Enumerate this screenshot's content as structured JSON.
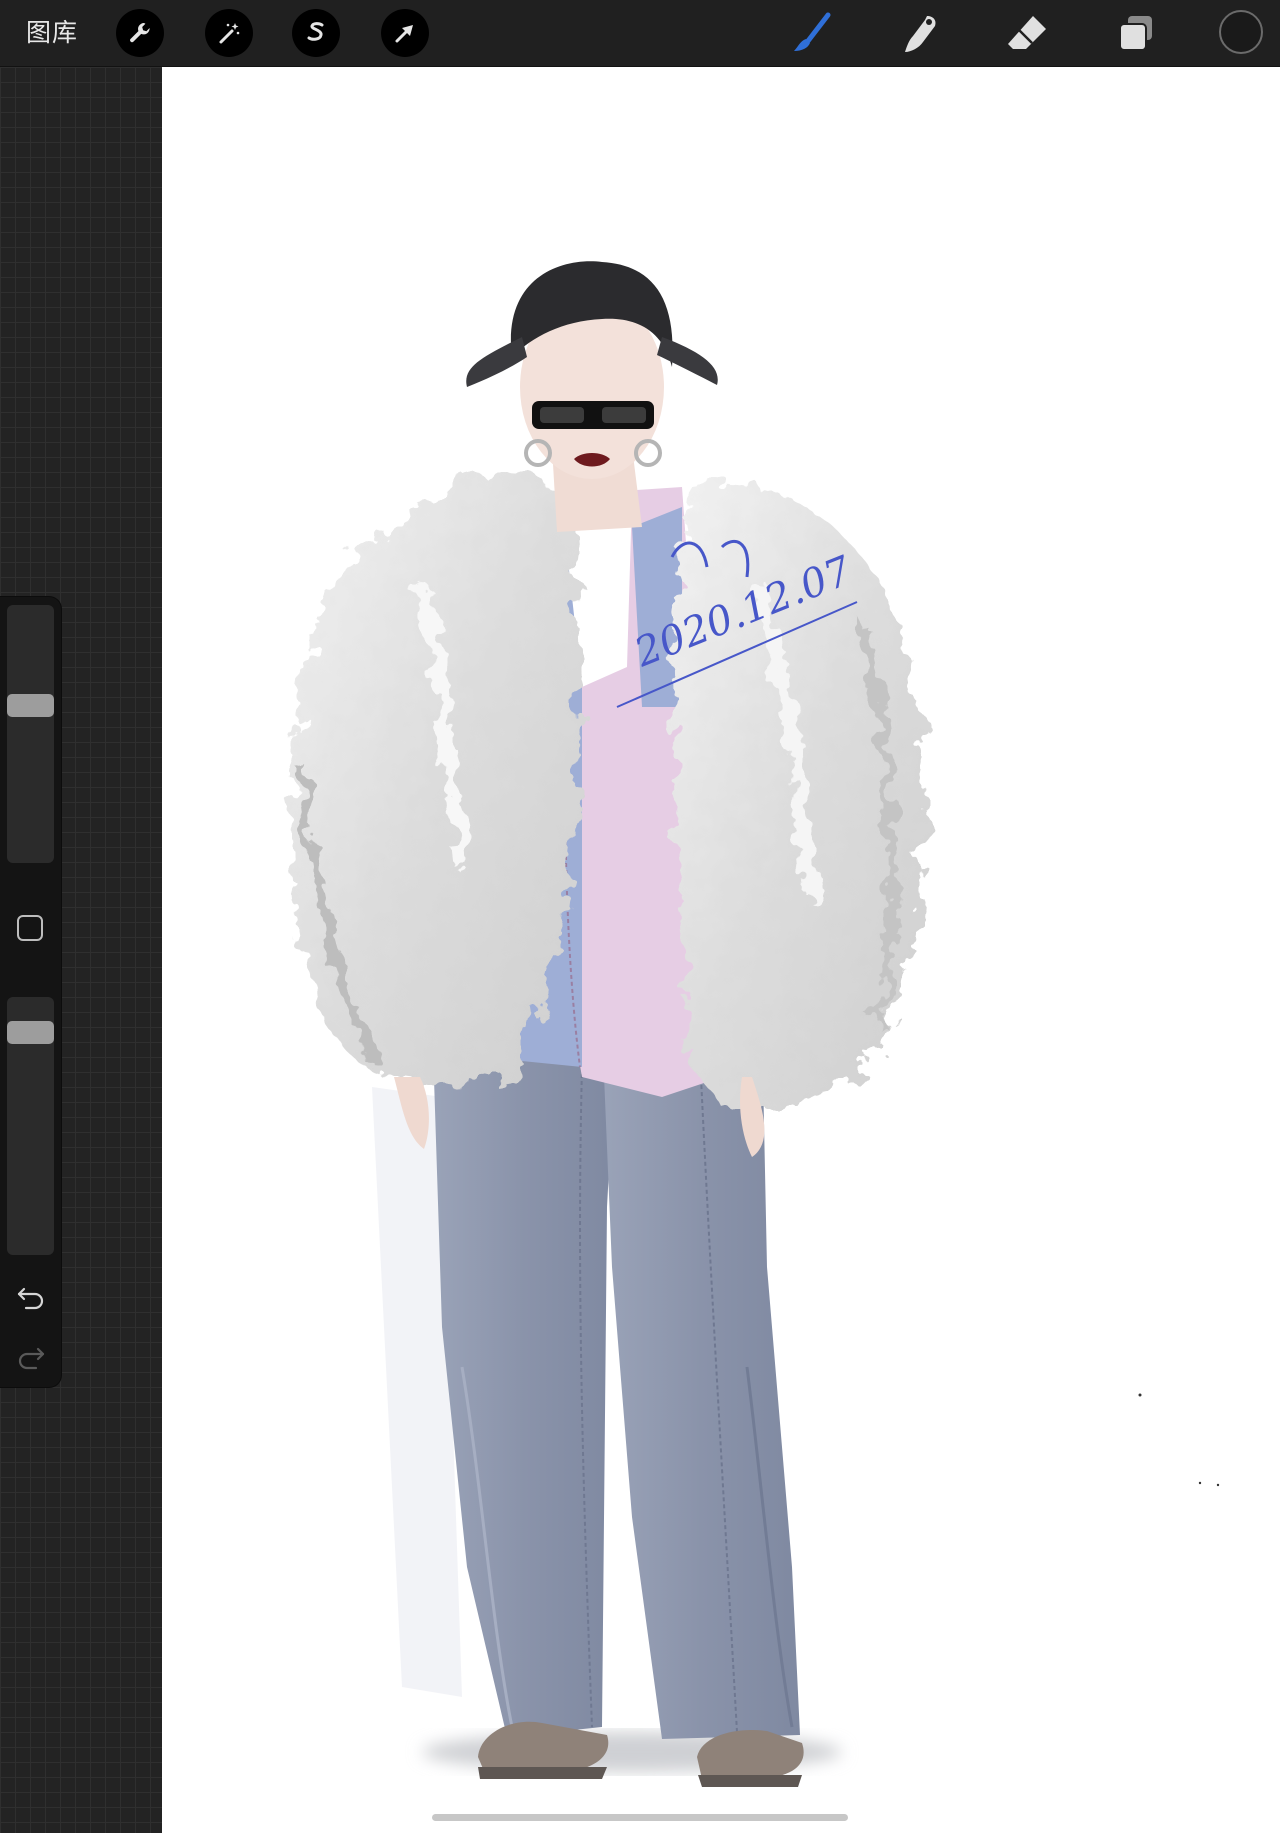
{
  "toolbar": {
    "gallery_label": "图库",
    "left_tools": [
      "wrench-icon",
      "magic-wand-icon",
      "selection-s-icon",
      "transform-arrow-icon"
    ],
    "right_tools": [
      "brush-icon",
      "smudge-icon",
      "eraser-icon",
      "layers-icon"
    ],
    "active_tool": "brush-icon",
    "active_color": "#1f1f1f",
    "accent": "#2f6fd8"
  },
  "sidebar": {
    "brush_size": 0.62,
    "opacity": 0.9,
    "icons": [
      "modify-square-icon",
      "undo-icon",
      "redo-icon"
    ]
  },
  "canvas": {
    "artwork": "fashion-illustration",
    "signature": "2020.12.07",
    "colors": {
      "fur": "#e6e6e6",
      "shirt_pink": "#e6cde4",
      "shirt_blue": "#9eaed6",
      "pants": "#8e97ad",
      "shoes": "#8f8279",
      "hair": "#2b2b2e",
      "lips": "#6e1a1e",
      "signature_ink": "#4757c9"
    }
  }
}
